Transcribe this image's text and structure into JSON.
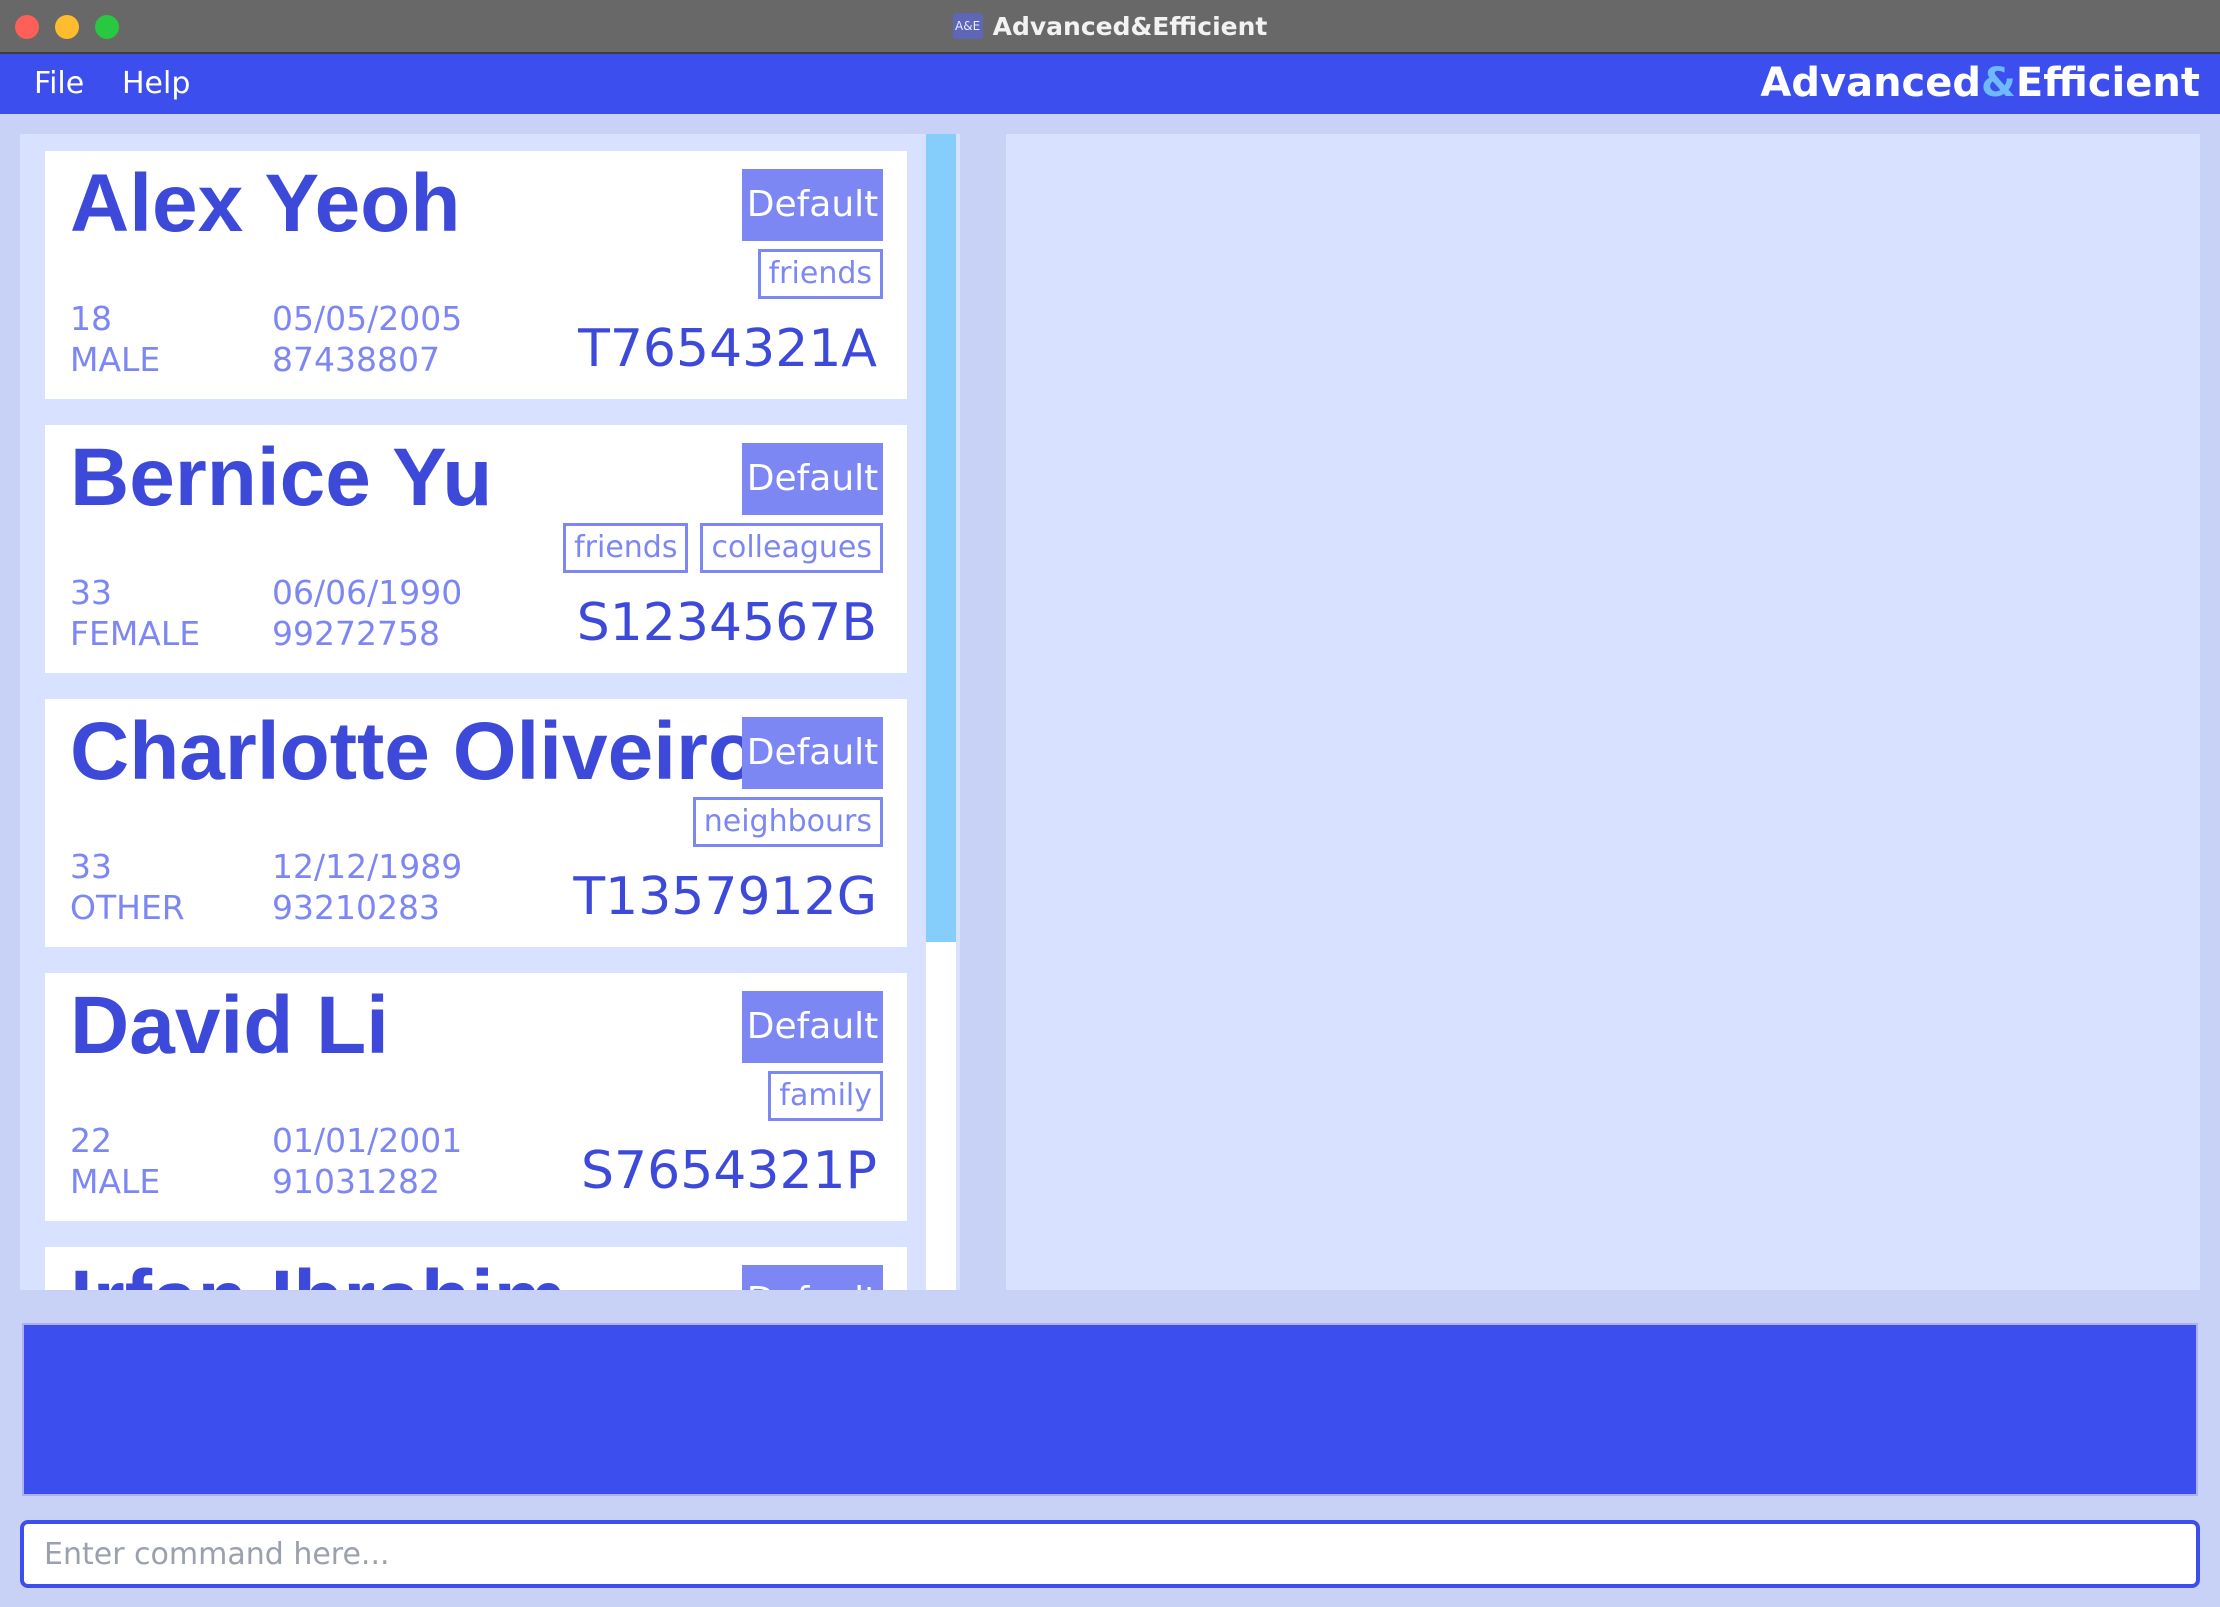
{
  "window": {
    "title": "Advanced&Efficient",
    "icon_text": "A&E"
  },
  "menu": {
    "file": "File",
    "help": "Help"
  },
  "brand": {
    "left": "Advanced",
    "amp": "&",
    "right": "Efficient"
  },
  "persons": [
    {
      "name": "Alex Yeoh",
      "button": "Default",
      "tags": [
        "friends"
      ],
      "age": "18",
      "gender": "MALE",
      "dob": "05/05/2005",
      "phone": "87438807",
      "id": "T7654321A"
    },
    {
      "name": "Bernice Yu",
      "button": "Default",
      "tags": [
        "friends",
        "colleagues"
      ],
      "age": "33",
      "gender": "FEMALE",
      "dob": "06/06/1990",
      "phone": "99272758",
      "id": "S1234567B"
    },
    {
      "name": "Charlotte Oliveiro",
      "button": "Default",
      "tags": [
        "neighbours"
      ],
      "age": "33",
      "gender": "OTHER",
      "dob": "12/12/1989",
      "phone": "93210283",
      "id": "T1357912G"
    },
    {
      "name": "David Li",
      "button": "Default",
      "tags": [
        "family"
      ],
      "age": "22",
      "gender": "MALE",
      "dob": "01/01/2001",
      "phone": "91031282",
      "id": "S7654321P"
    },
    {
      "name": "Irfan Ibrahim",
      "button": "Default",
      "tags": [],
      "age": "",
      "gender": "",
      "dob": "",
      "phone": "",
      "id": ""
    }
  ],
  "command": {
    "placeholder": "Enter command here..."
  },
  "colors": {
    "accent": "#3d4eef",
    "tag": "#7d87f4",
    "panel": "#d8e1ff",
    "scroll": "#85cdfb"
  }
}
